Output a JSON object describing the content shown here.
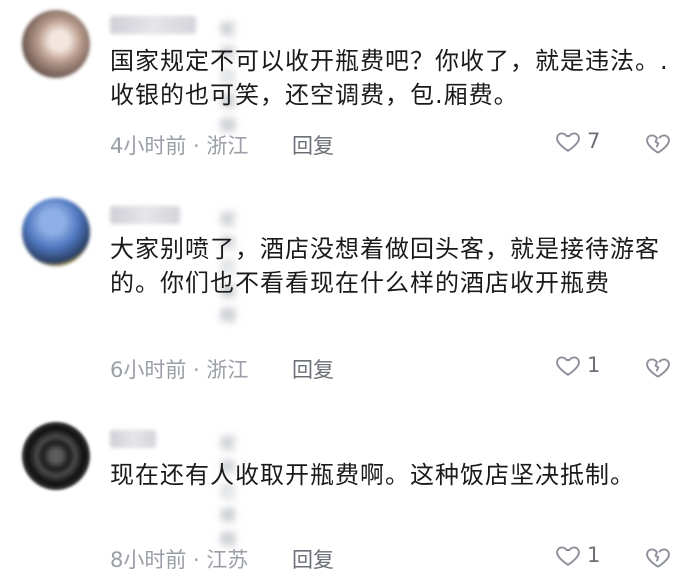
{
  "comments": [
    {
      "author": "昵称已模糊",
      "text": "国家规定不可以收开瓶费吧？你收了，就是违法。.收银的也可笑，还空调费，包.厢费。",
      "meta": "4小时前 · 浙江",
      "reply_label": "回复",
      "likes": "7"
    },
    {
      "author": "昵称已模糊",
      "text": "大家别喷了，酒店没想着做回头客，就是接待游客的。你们也不看看现在什么样的酒店收开瓶费",
      "meta": "6小时前 · 浙江",
      "reply_label": "回复",
      "likes": "1"
    },
    {
      "author": "昵称已模糊",
      "text": "现在还有人收取开瓶费啊。这种饭店坚决抵制。",
      "meta": "8小时前 · 江苏",
      "reply_label": "回复",
      "likes": "1"
    }
  ],
  "icons": {
    "like": "heart-icon",
    "dislike": "broken-heart-icon"
  }
}
